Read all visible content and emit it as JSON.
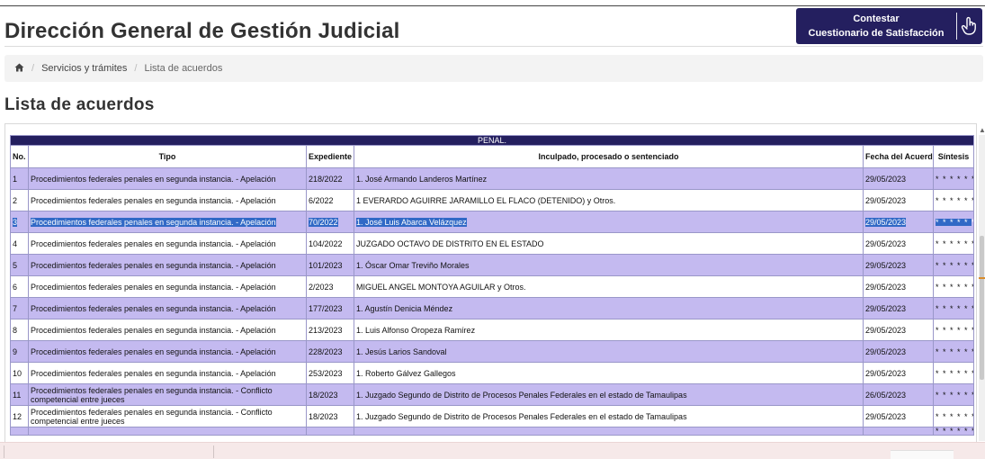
{
  "header": {
    "title": "Dirección General de Gestión Judicial",
    "survey_button": {
      "line1": "Contestar",
      "line2": "Cuestionario de Satisfacción",
      "icon": "hand-pointer-icon"
    }
  },
  "breadcrumb": {
    "home_icon": "home-icon",
    "items": [
      {
        "label": "Servicios y trámites"
      },
      {
        "label": "Lista de acuerdos"
      }
    ]
  },
  "section": {
    "title": "Lista de acuerdos"
  },
  "table": {
    "group_label": "PENAL",
    "group_suffix": ".",
    "columns": {
      "no": "No.",
      "tipo": "Tipo",
      "expediente": "Expediente",
      "inculpado": "Inculpado, procesado o sentenciado",
      "fecha": "Fecha del Acuerdo",
      "sintesis": "Síntesis"
    },
    "sintesis_placeholder": "* * * * * *",
    "rows": [
      {
        "no": "1",
        "tipo": "Procedimientos federales penales en segunda instancia. - Apelación",
        "expediente": "218/2022",
        "inculpado": "1. José Armando Landeros Martínez",
        "fecha": "29/05/2023",
        "sintesis": "* * * * * *"
      },
      {
        "no": "2",
        "tipo": "Procedimientos federales penales en segunda instancia. - Apelación",
        "expediente": "6/2022",
        "inculpado": "1 EVERARDO AGUIRRE JARAMILLO EL FLACO (DETENIDO) y Otros.",
        "fecha": "29/05/2023",
        "sintesis": "* * * * * *"
      },
      {
        "no": "3",
        "tipo": "Procedimientos federales penales en segunda instancia. - Apelación",
        "expediente": "70/2022",
        "inculpado": "1. José Luis Abarca Velázquez",
        "fecha": "29/05/2023",
        "sintesis": "* * * * * *",
        "selected": true
      },
      {
        "no": "4",
        "tipo": "Procedimientos federales penales en segunda instancia. - Apelación",
        "expediente": "104/2022",
        "inculpado": "JUZGADO OCTAVO DE DISTRITO EN EL ESTADO",
        "fecha": "29/05/2023",
        "sintesis": "* * * * * *"
      },
      {
        "no": "5",
        "tipo": "Procedimientos federales penales en segunda instancia. - Apelación",
        "expediente": "101/2023",
        "inculpado": "1. Óscar Omar Treviño Morales",
        "fecha": "29/05/2023",
        "sintesis": "* * * * * *"
      },
      {
        "no": "6",
        "tipo": "Procedimientos federales penales en segunda instancia. - Apelación",
        "expediente": "2/2023",
        "inculpado": "MIGUEL ANGEL MONTOYA AGUILAR y Otros.",
        "fecha": "29/05/2023",
        "sintesis": "* * * * * *"
      },
      {
        "no": "7",
        "tipo": "Procedimientos federales penales en segunda instancia. - Apelación",
        "expediente": "177/2023",
        "inculpado": "1. Agustín Denicia Méndez",
        "fecha": "29/05/2023",
        "sintesis": "* * * * * *"
      },
      {
        "no": "8",
        "tipo": "Procedimientos federales penales en segunda instancia. - Apelación",
        "expediente": "213/2023",
        "inculpado": "1. Luis Alfonso Oropeza Ramírez",
        "fecha": "29/05/2023",
        "sintesis": "* * * * * *"
      },
      {
        "no": "9",
        "tipo": "Procedimientos federales penales en segunda instancia. - Apelación",
        "expediente": "228/2023",
        "inculpado": "1. Jesús Larios Sandoval",
        "fecha": "29/05/2023",
        "sintesis": "* * * * * *"
      },
      {
        "no": "10",
        "tipo": "Procedimientos federales penales en segunda instancia. - Apelación",
        "expediente": "253/2023",
        "inculpado": "1. Roberto Gálvez Gallegos",
        "fecha": "29/05/2023",
        "sintesis": "* * * * * *"
      },
      {
        "no": "11",
        "tipo": "Procedimientos federales penales en segunda instancia. - Conflicto competencial entre jueces",
        "expediente": "18/2023",
        "inculpado": "1. Juzgado Segundo de Distrito de Procesos Penales Federales en el estado de Tamaulipas",
        "fecha": "26/05/2023",
        "sintesis": "* * * * * *"
      },
      {
        "no": "12",
        "tipo": "Procedimientos federales penales en segunda instancia. - Conflicto competencial entre jueces",
        "expediente": "18/2023",
        "inculpado": "1. Juzgado Segundo de Distrito de Procesos Penales Federales en el estado de Tamaulipas",
        "fecha": "29/05/2023",
        "sintesis": "* * * * * *"
      }
    ]
  }
}
